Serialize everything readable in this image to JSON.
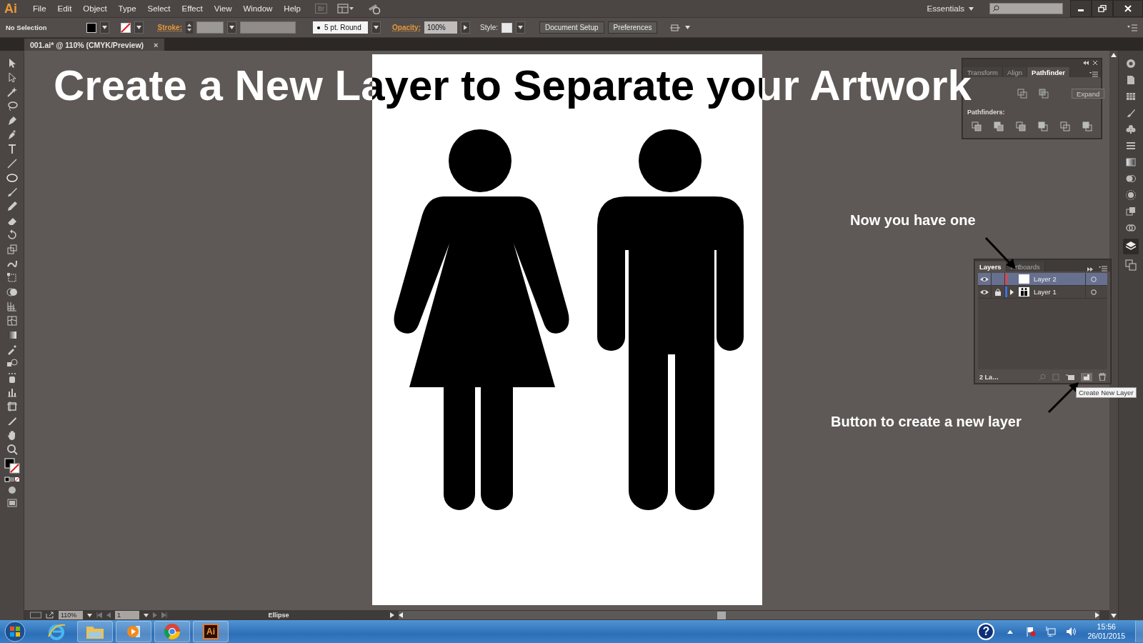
{
  "app_logo": "Ai",
  "menu": [
    "File",
    "Edit",
    "Object",
    "Type",
    "Select",
    "Effect",
    "View",
    "Window",
    "Help"
  ],
  "bridge": "Br",
  "workspace": "Essentials",
  "control_bar": {
    "selection": "No Selection",
    "stroke_label": "Stroke:",
    "brush": "5 pt. Round",
    "opacity_label": "Opacity:",
    "opacity": "100%",
    "style_label": "Style:",
    "buttons": [
      "Document Setup",
      "Preferences"
    ]
  },
  "document_tab": {
    "title": "001.ai* @ 110% (CMYK/Preview)",
    "close": "×"
  },
  "headline": "Create a New Layer to Separate your Artwork",
  "pathfinder_panel": {
    "tabs": [
      {
        "label": "Transform",
        "selected": false
      },
      {
        "label": "Align",
        "selected": false
      },
      {
        "label": "Pathfinder",
        "selected": true
      }
    ],
    "expand": "Expand",
    "section": "Pathfinders:"
  },
  "layers_panel": {
    "tabs": [
      {
        "label": "Layers",
        "selected": true
      },
      {
        "label": "Artboards",
        "selected": false
      }
    ],
    "layers": [
      {
        "name": "Layer 2",
        "selected": true,
        "visible": true,
        "locked": false,
        "expandable": false,
        "color": "#e0454f"
      },
      {
        "name": "Layer 1",
        "selected": false,
        "visible": true,
        "locked": true,
        "expandable": true,
        "color": "#3f6fe0"
      }
    ],
    "count": "2 La…"
  },
  "annotations": [
    "Now you have one",
    "Button to create a new layer"
  ],
  "tooltip": "Create New Layer",
  "status_bar": {
    "zoom": "110%",
    "page": "1",
    "tool": "Ellipse"
  },
  "taskbar": {
    "apps": [
      {
        "kind": "ie",
        "running": false
      },
      {
        "kind": "folder",
        "running": true
      },
      {
        "kind": "media",
        "running": true
      },
      {
        "kind": "chrome",
        "running": true
      },
      {
        "kind": "illustrator",
        "running": true,
        "label": "Ai"
      }
    ],
    "help": "?",
    "time": "15:56",
    "date": "26/01/2015"
  }
}
